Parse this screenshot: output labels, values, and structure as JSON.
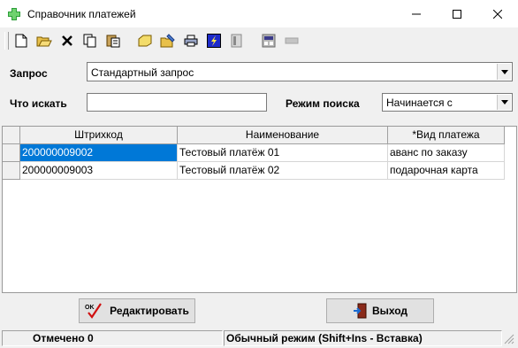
{
  "window": {
    "title": "Справочник платежей"
  },
  "toolbar": {
    "icons": [
      "new-document-icon",
      "open-folder-icon",
      "delete-icon",
      "copy-icon",
      "paste-icon",
      "tag-icon",
      "open-folder-edit-icon",
      "print-icon",
      "lightning-icon",
      "report-icon",
      "calculator-icon",
      "disabled-icon"
    ]
  },
  "query": {
    "label": "Запрос",
    "value": "Стандартный запрос"
  },
  "search": {
    "label": "Что искать",
    "value": "",
    "mode_label": "Режим поиска",
    "mode_value": "Начинается с"
  },
  "grid": {
    "columns": [
      "Штрихкод",
      "Наименование",
      "*Вид платежа"
    ],
    "rows": [
      {
        "barcode": "200000009002",
        "name": "Тестовый платёж 01",
        "type": "аванс по заказу"
      },
      {
        "barcode": "200000009003",
        "name": "Тестовый платёж 02",
        "type": "подарочная карта"
      }
    ]
  },
  "buttons": {
    "edit": "Редактировать",
    "exit": "Выход"
  },
  "status": {
    "marked_label": "Отмечено",
    "marked_value": "0",
    "mode": "Обычный режим (Shift+Ins - Вставка)"
  },
  "colors": {
    "selection": "#0078d7"
  }
}
